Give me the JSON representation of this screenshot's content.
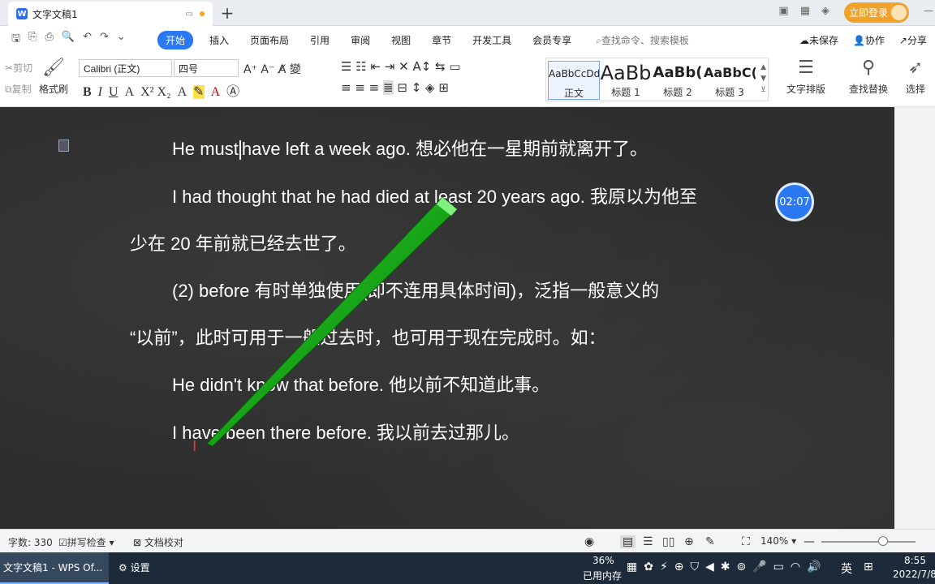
{
  "tabbar": {
    "doc_title": "文字文稿1",
    "new_tab": "+",
    "login_label": "立即登录"
  },
  "menu": {
    "tabs": [
      "开始",
      "插入",
      "页面布局",
      "引用",
      "审阅",
      "视图",
      "章节",
      "开发工具",
      "会员专享"
    ],
    "search_placeholder": "查找命令、搜索模板",
    "unsaved": "未保存",
    "collab": "协作",
    "share": "分享"
  },
  "ribbon": {
    "cut": "剪切",
    "copy": "复制",
    "format_painter": "格式刷",
    "font_name": "Calibri (正文)",
    "font_size": "四号",
    "styles": [
      {
        "preview": "AaBbCcDd",
        "label": "正文"
      },
      {
        "preview": "AaBb",
        "label": "标题 1"
      },
      {
        "preview": "AaBb(",
        "label": "标题 2"
      },
      {
        "preview": "AaBbC(",
        "label": "标题 3"
      }
    ],
    "text_layout": "文字排版",
    "find_replace": "查找替换",
    "select": "选择"
  },
  "document": {
    "lines": [
      {
        "before": "He must",
        "after": "have left a week ago.  想必他在一星期前就离开了。"
      },
      {
        "text": "I had thought that he had died at least 20 years ago.  我原以为他至"
      },
      {
        "text": "少在  20  年前就已经去世了。"
      },
      {
        "text": "(2) before  有时单独使用(即不连用具体时间)，泛指一般意义的"
      },
      {
        "text": "“以前”，此时可用于一般过去时，也可用于现在完成时。如："
      },
      {
        "text": "He didn't know that before.  他以前不知道此事。"
      },
      {
        "text": "I have been there before.  我以前去过那儿。"
      }
    ],
    "timer": "02:07"
  },
  "statusbar": {
    "word_count": "字数: 330",
    "spell_check": "拼写检查",
    "doc_proof": "文档校对",
    "zoom": "140%"
  },
  "taskbar": {
    "active_window": "文字文稿1 - WPS Of...",
    "settings": "设置",
    "memory_percent": "36%",
    "memory_label": "已用内存",
    "ime": "英",
    "time": "8:55",
    "date": "2022/7/8"
  }
}
